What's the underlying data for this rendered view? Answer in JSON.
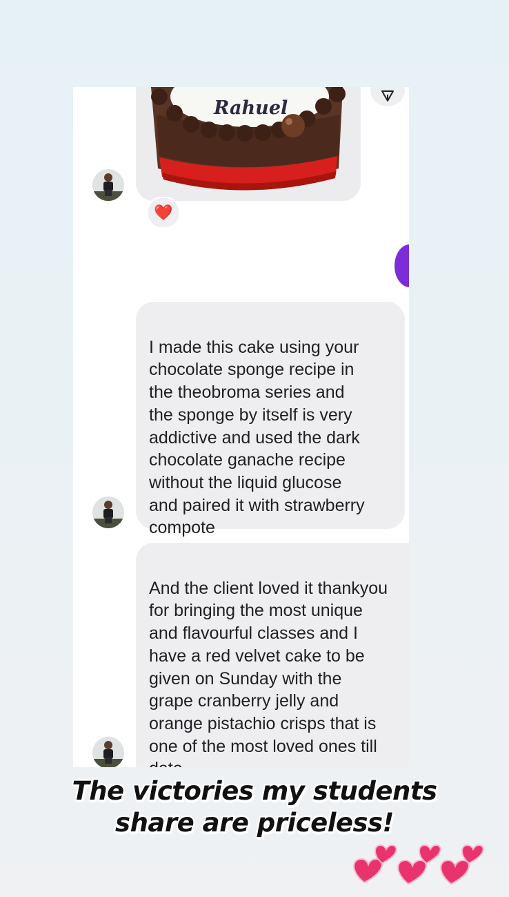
{
  "messages": [
    {
      "text": "I made this cake using your\nchocolate sponge recipe in\nthe theobroma series and\nthe sponge by itself is very\naddictive and used the dark\nchocolate ganache recipe\nwithout the liquid glucose\nand paired it with strawberry\ncompote"
    },
    {
      "text": "And the client loved it thankyou\nfor bringing the most unique\nand flavourful classes and I\nhave a red velvet cake to be\ngiven on Sunday with the\ngrape cranberry jelly and\norange pistachio crisps that is\none of the most loved ones till\ndate",
      "emojis": "😁😍"
    }
  ],
  "cake_text": "Rahuel",
  "reaction": "❤️",
  "caption": {
    "line1": "The victories my students",
    "line2": "share are priceless!"
  },
  "icons": {
    "share": "share-icon",
    "reaction": "heart-icon",
    "decor": "two-hearts-icon"
  },
  "colors": {
    "bubble": "#eeeef1",
    "accent": "#7b2ed8",
    "heart": "#e8336d"
  }
}
